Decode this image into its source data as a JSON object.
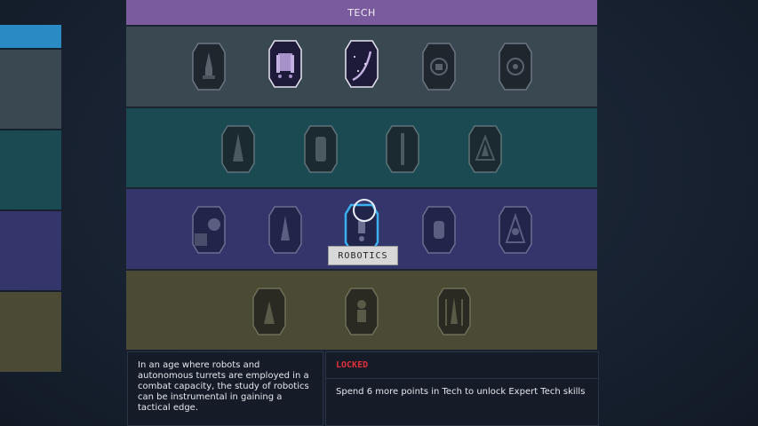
{
  "colors": {
    "tier1": "#3a4852",
    "tier2": "#1c4a52",
    "tier3": "#33356b",
    "tier4": "#4a4a35",
    "header": "#7a5c9e",
    "side_blue": "#2a8bc4",
    "locked_red": "#e0303a"
  },
  "header": {
    "title": "TECH"
  },
  "tiers": [
    {
      "name": "tier-1",
      "skills": [
        {
          "icon": "rocket-ship-icon",
          "state": "locked"
        },
        {
          "icon": "thrusters-icon",
          "state": "purchased"
        },
        {
          "icon": "space-flight-icon",
          "state": "purchased"
        },
        {
          "icon": "security-lock-icon",
          "state": "locked"
        },
        {
          "icon": "targeting-reticle-icon",
          "state": "locked"
        }
      ]
    },
    {
      "name": "tier-2",
      "skills": [
        {
          "icon": "starship-design-icon",
          "state": "locked"
        },
        {
          "icon": "engine-icon",
          "state": "locked"
        },
        {
          "icon": "ballistic-column-icon",
          "state": "locked"
        },
        {
          "icon": "ship-triangle-icon",
          "state": "locked"
        }
      ]
    },
    {
      "name": "tier-3",
      "skills": [
        {
          "icon": "planet-icon",
          "state": "locked"
        },
        {
          "icon": "starship-engineering-icon",
          "state": "locked"
        },
        {
          "icon": "robotics-icon",
          "state": "selected"
        },
        {
          "icon": "outpost-icon",
          "state": "locked"
        },
        {
          "icon": "compass-icon",
          "state": "locked"
        }
      ]
    },
    {
      "name": "tier-4",
      "skills": [
        {
          "icon": "launch-icon",
          "state": "locked"
        },
        {
          "icon": "astronaut-icon",
          "state": "locked"
        },
        {
          "icon": "rocket-tower-icon",
          "state": "locked"
        }
      ]
    }
  ],
  "tooltip": {
    "label": "ROBOTICS"
  },
  "description": {
    "text": "In an age where robots and autonomous turrets are employed in a combat capacity, the study of robotics can be instrumental in gaining a tactical edge."
  },
  "lock_info": {
    "title": "LOCKED",
    "text": "Spend 6 more points in Tech to unlock Expert Tech skills"
  }
}
